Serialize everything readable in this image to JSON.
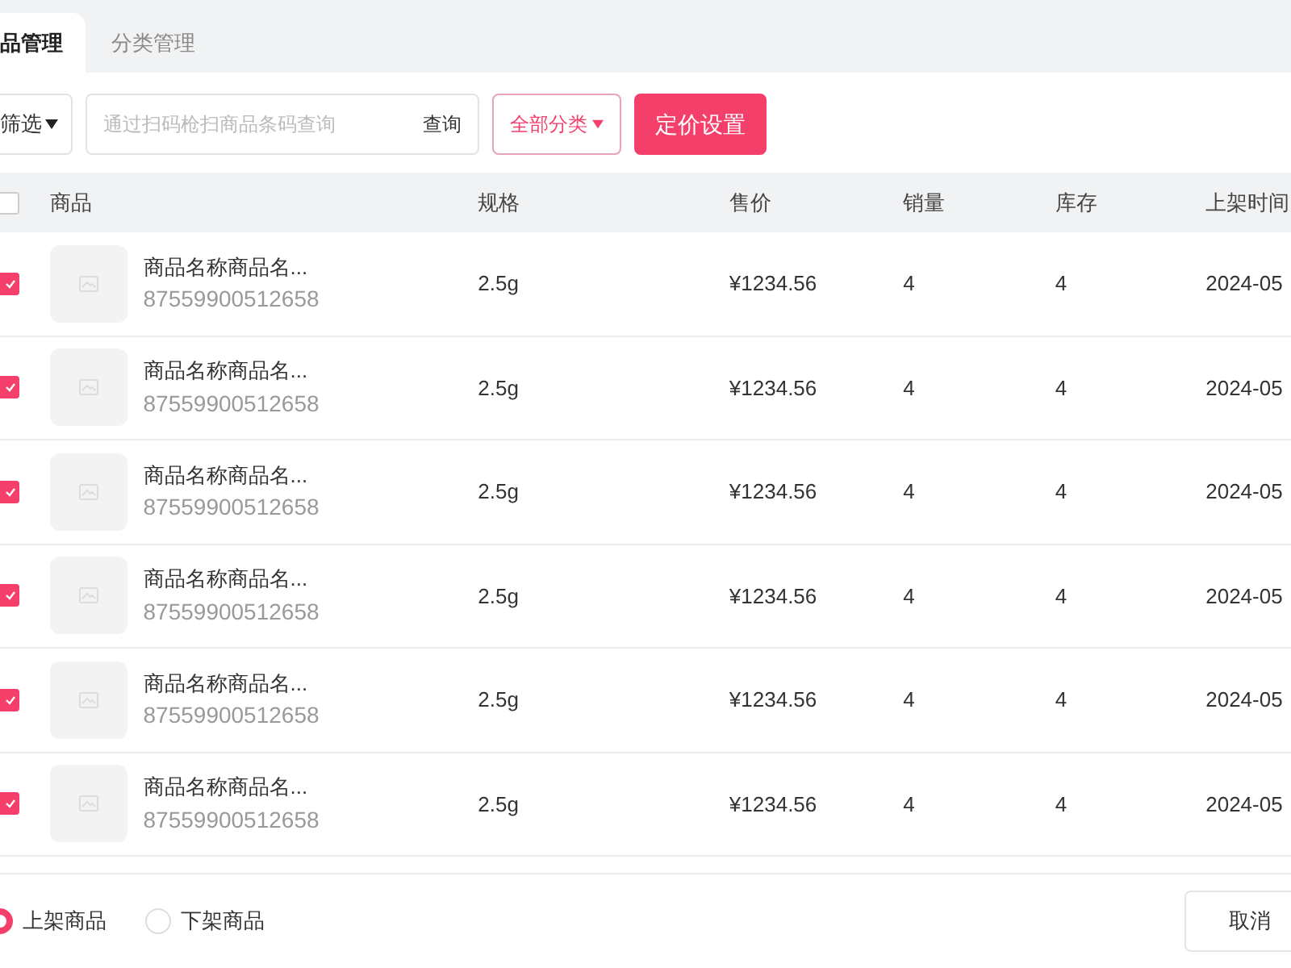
{
  "tabs": [
    {
      "label": "品管理",
      "selected": true
    },
    {
      "label": "分类管理",
      "selected": false
    }
  ],
  "toolbar": {
    "filter": "筛选",
    "search": {
      "placeholder": "通过扫码枪扫商品条码查询",
      "button": "查询"
    },
    "category": "全部分类",
    "pricing": "定价设置"
  },
  "table": {
    "select_all": {
      "checked": false
    },
    "columns": [
      "商品",
      "规格",
      "售价",
      "销量",
      "库存",
      "上架时间"
    ],
    "rows": [
      {
        "checked": true,
        "name": "商品名称商品名...",
        "barcode": "87559900512658",
        "spec": "2.5g",
        "price": "¥1234.56",
        "sales": "4",
        "stock": "4",
        "date": "2024-05"
      },
      {
        "checked": true,
        "name": "商品名称商品名...",
        "barcode": "87559900512658",
        "spec": "2.5g",
        "price": "¥1234.56",
        "sales": "4",
        "stock": "4",
        "date": "2024-05"
      },
      {
        "checked": true,
        "name": "商品名称商品名...",
        "barcode": "87559900512658",
        "spec": "2.5g",
        "price": "¥1234.56",
        "sales": "4",
        "stock": "4",
        "date": "2024-05"
      },
      {
        "checked": true,
        "name": "商品名称商品名...",
        "barcode": "87559900512658",
        "spec": "2.5g",
        "price": "¥1234.56",
        "sales": "4",
        "stock": "4",
        "date": "2024-05"
      },
      {
        "checked": true,
        "name": "商品名称商品名...",
        "barcode": "87559900512658",
        "spec": "2.5g",
        "price": "¥1234.56",
        "sales": "4",
        "stock": "4",
        "date": "2024-05"
      },
      {
        "checked": true,
        "name": "商品名称商品名...",
        "barcode": "87559900512658",
        "spec": "2.5g",
        "price": "¥1234.56",
        "sales": "4",
        "stock": "4",
        "date": "2024-05"
      }
    ]
  },
  "footer": {
    "options": [
      {
        "label": "上架商品",
        "selected": true
      },
      {
        "label": "下架商品",
        "selected": false
      }
    ],
    "cancel": "取消"
  }
}
